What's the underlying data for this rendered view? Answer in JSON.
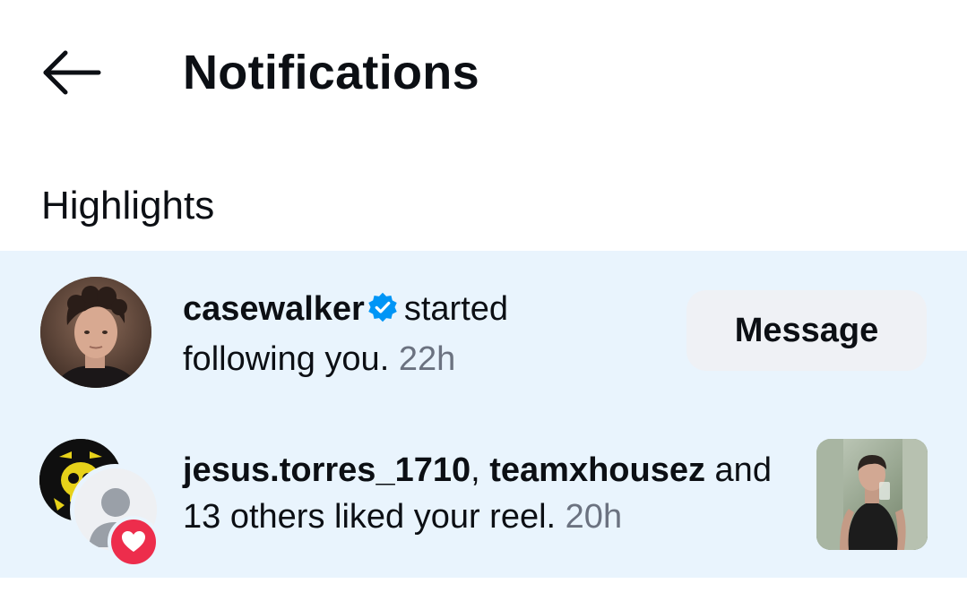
{
  "header": {
    "title": "Notifications",
    "back_icon": "arrow-left-icon"
  },
  "section": {
    "title": "Highlights"
  },
  "notifications": [
    {
      "type": "follow",
      "username": "casewalker",
      "verified": true,
      "action": "started following you.",
      "time": "22h",
      "button_label": "Message"
    },
    {
      "type": "like",
      "username_1": "jesus.torres_1710",
      "separator": ",",
      "username_2": "teamxhousez",
      "connector": "and",
      "action": "13 others liked your reel.",
      "time": "20h",
      "badge_icon": "heart-icon"
    }
  ],
  "colors": {
    "highlight_bg": "#e9f4fd",
    "verified_blue": "#0095f6",
    "heart_red": "#ed2d4c",
    "button_bg": "#eff1f5",
    "time_gray": "#6b7280"
  }
}
